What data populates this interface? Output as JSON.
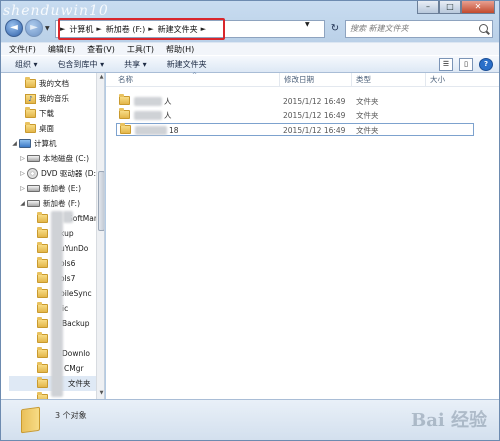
{
  "watermark_top": "shenduwin10",
  "window": {
    "caption_minimize": "–",
    "caption_maximize": "□",
    "caption_close": "✕"
  },
  "nav": {
    "back_glyph": "◄",
    "forward_glyph": "►",
    "breadcrumbs": [
      "计算机",
      "新加卷 (F:)",
      "新建文件夹"
    ],
    "crumb_sep": "►",
    "refresh_glyph": "↻",
    "search_placeholder": "搜索 新建文件夹"
  },
  "menubar": [
    "文件(F)",
    "编辑(E)",
    "查看(V)",
    "工具(T)",
    "帮助(H)"
  ],
  "toolbar": {
    "organize": "组织 ▾",
    "include_library": "包含到库中 ▾",
    "share": "共享 ▾",
    "new_folder": "新建文件夹",
    "help_glyph": "?"
  },
  "nav_tree": {
    "favorites": [
      {
        "label": "我的文档",
        "icon": "folder-icon"
      },
      {
        "label": "我的音乐",
        "icon": "music-folder-icon"
      },
      {
        "label": "下载",
        "icon": "folder-icon"
      },
      {
        "label": "桌面",
        "icon": "folder-icon"
      }
    ],
    "computer": "计算机",
    "drives": [
      {
        "label": "本地磁盘 (C:)",
        "icon": "drive-icon"
      },
      {
        "label": "DVD 驱动器 (D:)",
        "icon": "dvd-icon"
      },
      {
        "label": "新加卷 (E:)",
        "icon": "drive-icon"
      },
      {
        "label": "新加卷 (F:)",
        "icon": "drive-icon"
      }
    ],
    "folders_f": [
      "SoftMan",
      "kup",
      "uYunDo",
      "ols6",
      "ols7",
      "bileSync",
      "ic",
      "Backup",
      "",
      "Downlo",
      "CMgr",
      "文件夹",
      ""
    ]
  },
  "columns": [
    "名称",
    "修改日期",
    "类型",
    "大小"
  ],
  "files": [
    {
      "name": "人",
      "date": "2015/1/12 16:49",
      "type": "文件夹",
      "size": ""
    },
    {
      "name": "人",
      "date": "2015/1/12 16:49",
      "type": "文件夹",
      "size": ""
    },
    {
      "name": "18",
      "date": "2015/1/12 16:49",
      "type": "文件夹",
      "size": ""
    }
  ],
  "status": {
    "count_text": "3 个对象"
  },
  "watermark_bottom": "Bai 经验"
}
